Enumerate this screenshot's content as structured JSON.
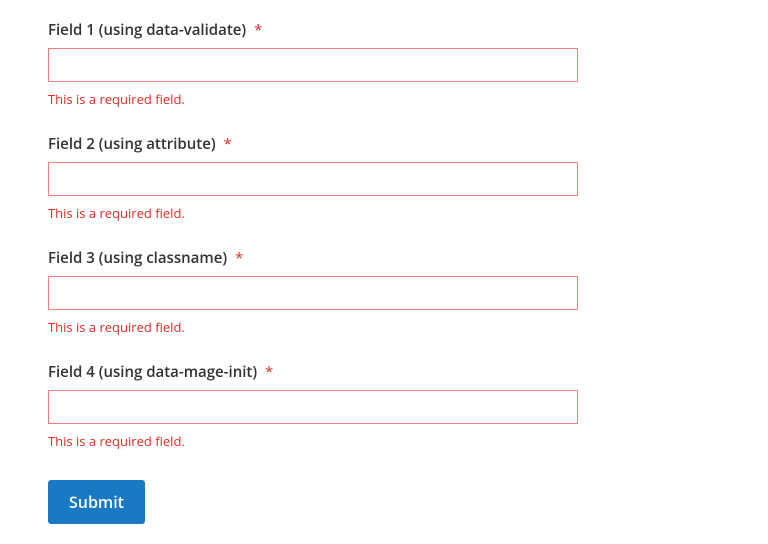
{
  "fields": [
    {
      "label": "Field 1 (using data-validate)",
      "error": "This is a required field.",
      "value": ""
    },
    {
      "label": "Field 2 (using attribute)",
      "error": "This is a required field.",
      "value": ""
    },
    {
      "label": "Field 3 (using classname)",
      "error": "This is a required field.",
      "value": ""
    },
    {
      "label": "Field 4 (using data-mage-init)",
      "error": "This is a required field.",
      "value": ""
    }
  ],
  "required_marker": "*",
  "actions": {
    "submit_label": "Submit"
  },
  "colors": {
    "error": "#e02b27",
    "primary": "#1979c3",
    "input_border_error": "#ed7f7c"
  }
}
